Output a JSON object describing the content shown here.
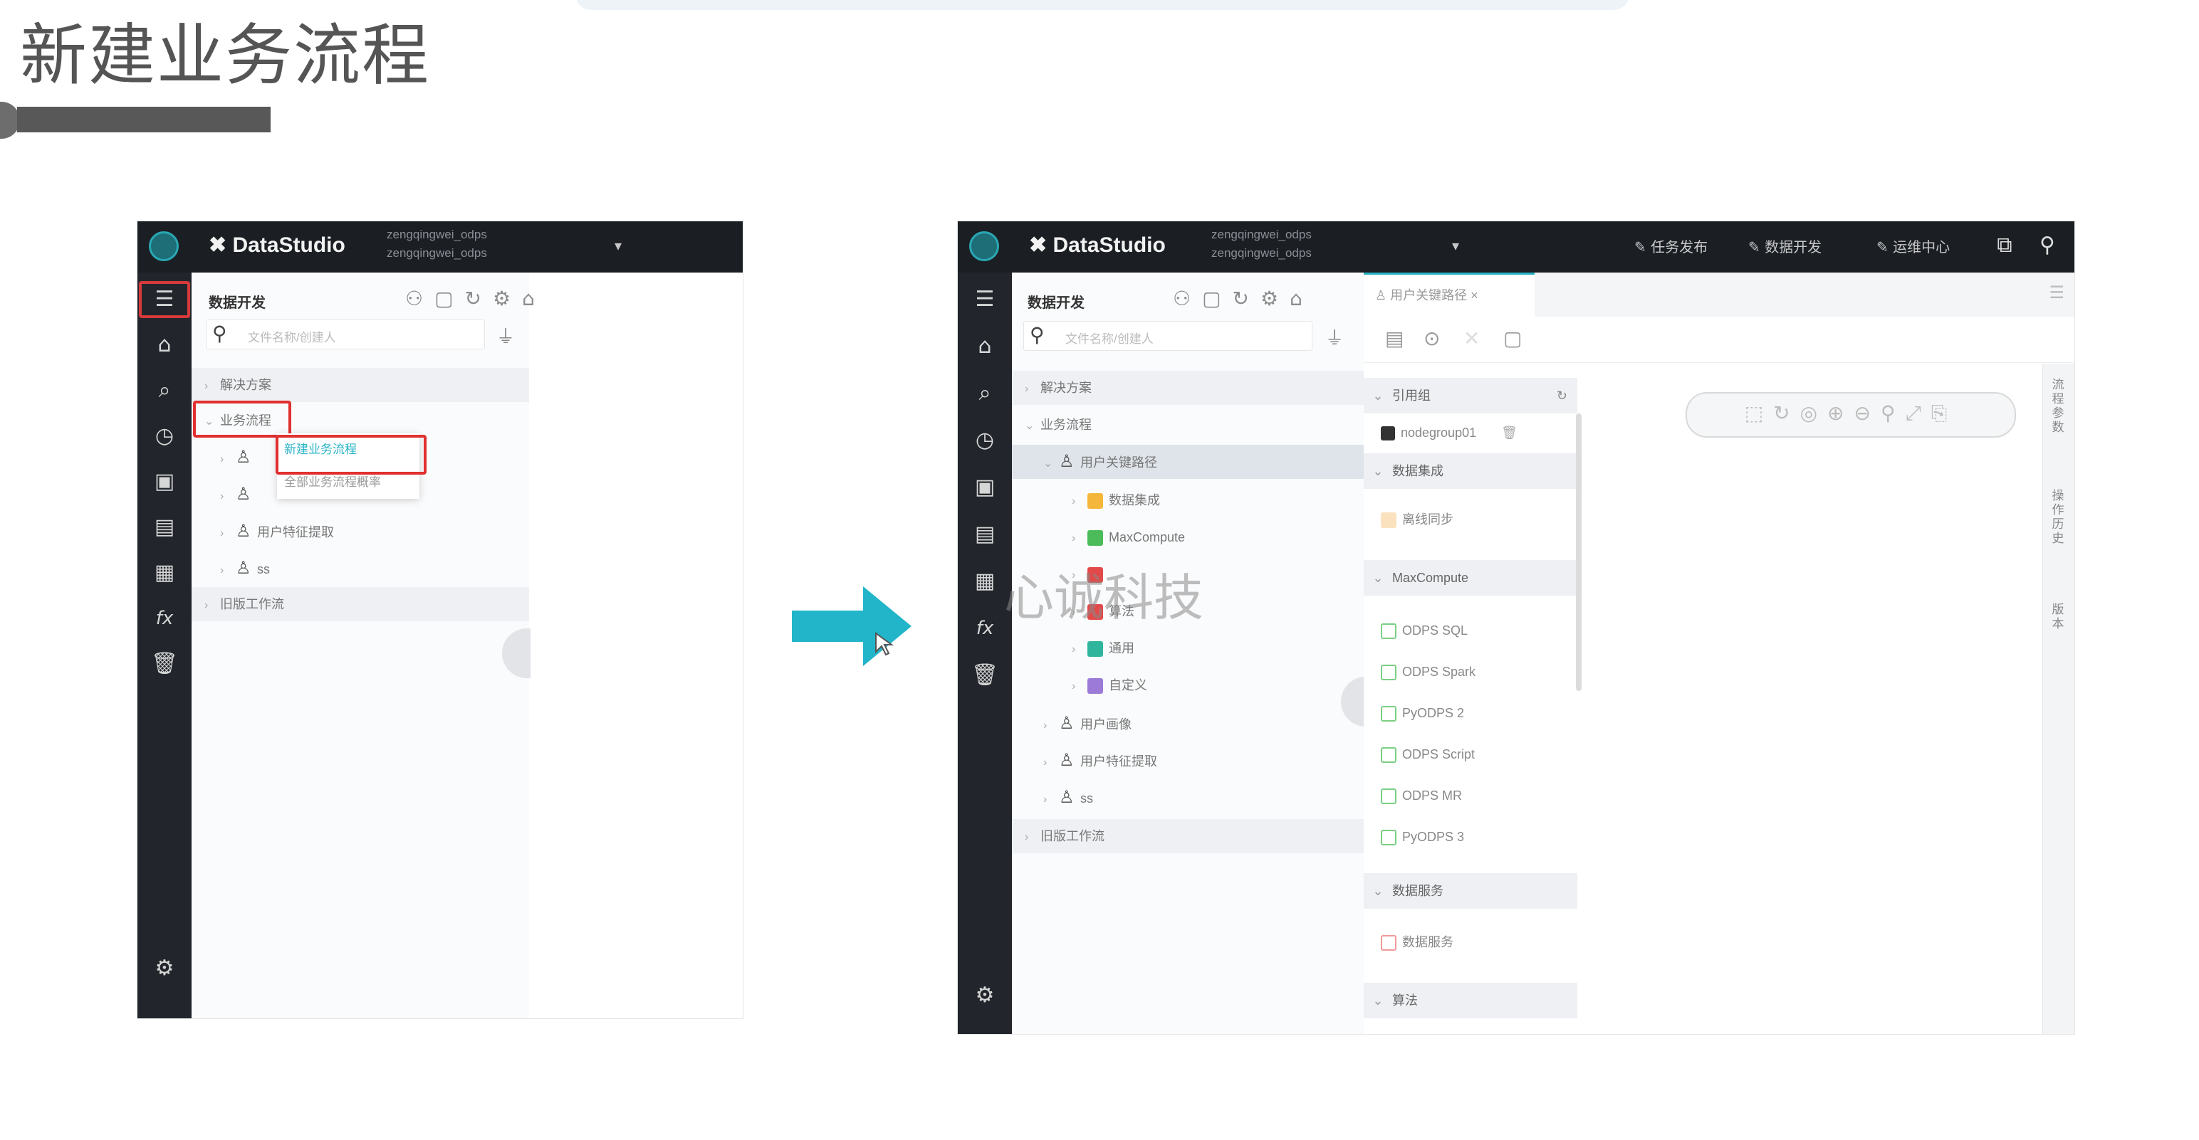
{
  "slide": {
    "title": "新建业务流程"
  },
  "colors": {
    "accent": "#2cb4c8",
    "highlight": "#e0302f",
    "topbar": "#1b1f24",
    "arrow": "#22b5c9"
  },
  "left_screenshot": {
    "brand": "DataStudio",
    "project_line1": "zengqingwei_odps",
    "project_line2": "zengqingwei_odps",
    "panel_title": "数据开发",
    "search_placeholder": "文件名称/创建人",
    "tree": [
      {
        "label": "解决方案"
      },
      {
        "label": "业务流程"
      },
      {
        "label": ""
      },
      {
        "label": ""
      },
      {
        "label": "用户特征提取"
      },
      {
        "label": "ss"
      },
      {
        "label": "旧版工作流"
      }
    ],
    "context_menu": [
      "新建业务流程",
      "全部业务流程概率"
    ]
  },
  "right_screenshot": {
    "brand": "DataStudio",
    "project_line1": "zengqingwei_odps",
    "project_line2": "zengqingwei_odps",
    "top_actions": [
      "任务发布",
      "数据开发",
      "运维中心"
    ],
    "panel_title": "数据开发",
    "search_placeholder": "文件名称/创建人",
    "tree": [
      {
        "label": "解决方案"
      },
      {
        "label": "业务流程"
      },
      {
        "label": "用户关键路径"
      },
      {
        "label": "数据集成"
      },
      {
        "label": "MaxCompute"
      },
      {
        "label": ""
      },
      {
        "label": "算法"
      },
      {
        "label": "通用"
      },
      {
        "label": "自定义"
      },
      {
        "label": "用户画像"
      },
      {
        "label": "用户特征提取"
      },
      {
        "label": "ss"
      },
      {
        "label": "旧版工作流"
      }
    ],
    "tab_label": "用户关键路径",
    "components": {
      "sections": [
        "引用组",
        "数据集成",
        "MaxCompute",
        "数据服务",
        "算法"
      ],
      "ref_item": "nodegroup01",
      "integration_item": "离线同步",
      "maxcompute_items": [
        "ODPS SQL",
        "ODPS Spark",
        "PyODPS 2",
        "ODPS Script",
        "ODPS MR",
        "PyODPS 3"
      ],
      "service_item": "数据服务"
    },
    "right_rail": [
      "流程参数",
      "操作历史",
      "版本"
    ]
  },
  "watermark": "心诚科技"
}
